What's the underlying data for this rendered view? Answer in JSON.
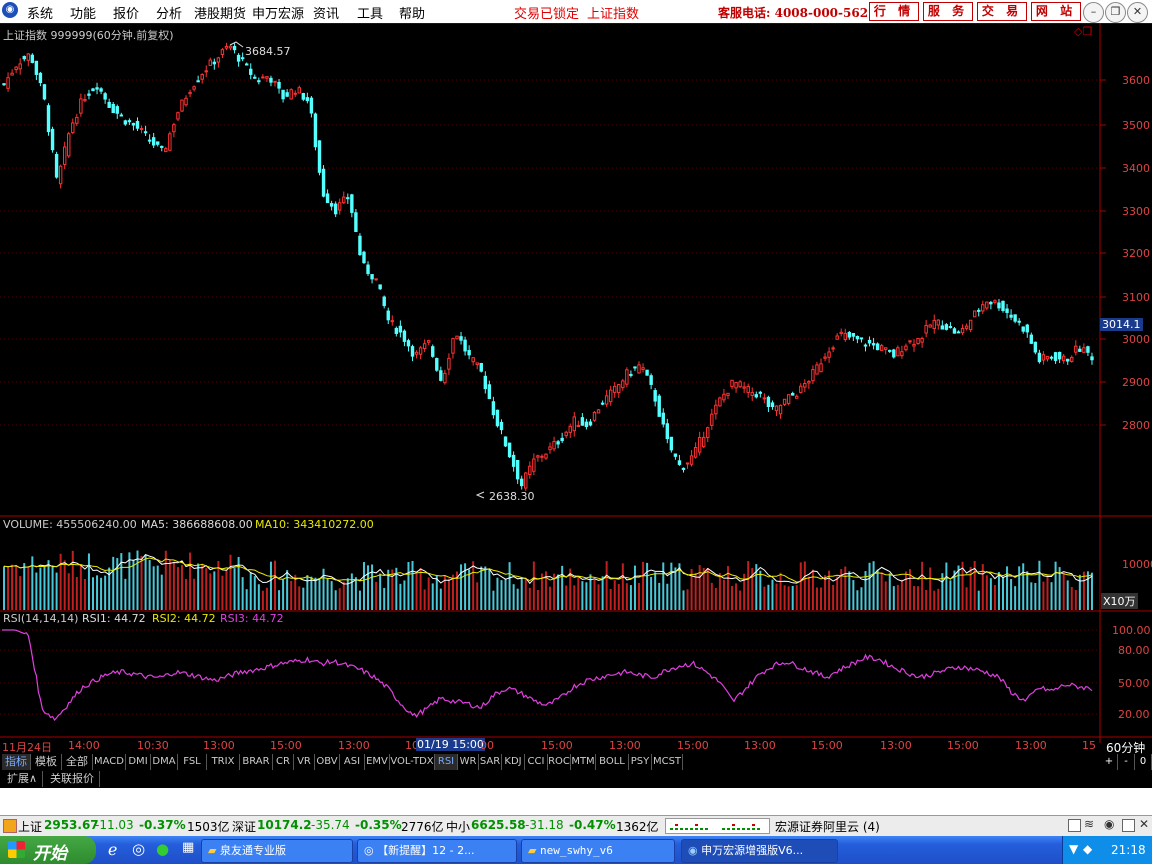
{
  "menubar": {
    "items": [
      "系统",
      "功能",
      "报价",
      "分析",
      "港股期货",
      "申万宏源",
      "资讯",
      "工具",
      "帮助"
    ],
    "lock_status": "交易已锁定",
    "index_name": "上证指数",
    "hotline": "客服电话: 4008-000-562",
    "buttons": [
      "行 情",
      "服 务",
      "交 易",
      "网 站"
    ]
  },
  "price_panel": {
    "title": "上证指数 999999(60分钟.前复权)",
    "high_label": "3684.57",
    "low_label": "2638.30",
    "current_price": "3014.1",
    "y_ticks": [
      "3600",
      "3500",
      "3400",
      "3300",
      "3200",
      "3100",
      "3000",
      "2900",
      "2800"
    ]
  },
  "volume_panel": {
    "prefix": "VOLUME: ",
    "volume": "455506240.00",
    "ma5_label": "MA5: ",
    "ma5": "386688608.00",
    "ma10_label": "MA10: ",
    "ma10": "343410272.00",
    "y_tick": "10000",
    "unit": "X10万"
  },
  "rsi_panel": {
    "title": "RSI(14,14,14)",
    "rsi1": "RSI1: 44.72",
    "rsi2": "RSI2: 44.72",
    "rsi3": "RSI3: 44.72",
    "y_ticks": [
      "100.00",
      "80.00",
      "50.00",
      "20.00"
    ]
  },
  "time_axis": {
    "labels": [
      "11月24日",
      "14:00",
      "10:30",
      "13:00",
      "15:00",
      "13:00",
      "10",
      "01/19 15:00",
      "00",
      "15:00",
      "13:00",
      "15:00",
      "13:00",
      "15:00",
      "13:00",
      "15:00",
      "13:00",
      "15"
    ],
    "period": "60分钟"
  },
  "indicator_tabs": [
    "指标",
    "模板",
    "全部",
    "MACD",
    "DMI",
    "DMA",
    "FSL",
    "TRIX",
    "BRAR",
    "CR",
    "VR",
    "OBV",
    "ASI",
    "EMV",
    "VOL-TDX",
    "RSI",
    "WR",
    "SAR",
    "KDJ",
    "CCI",
    "ROC",
    "MTM",
    "BOLL",
    "PSY",
    "MCST"
  ],
  "zoom_controls": [
    "+",
    "-",
    "0"
  ],
  "extension_row": [
    "扩展∧",
    "关联报价"
  ],
  "status_bar": {
    "sh_name": "上证",
    "sh_val": "2953.67",
    "sh_chg": "-11.03",
    "sh_pct": "-0.37%",
    "sh_amt": "1503亿",
    "sz_name": "深证",
    "sz_val": "10174.2",
    "sz_chg": "-35.74",
    "sz_pct": "-0.35%",
    "sz_amt": "2776亿",
    "zx_name": "中小",
    "zx_val": "6625.58",
    "zx_chg": "-31.18",
    "zx_pct": "-0.47%",
    "zx_amt": "1362亿",
    "broker": "宏源证券阿里云 (4)"
  },
  "taskbar": {
    "start": "开始",
    "tasks": [
      "泉友通专业版",
      "【新提醒】12 - 2...",
      "new_swhy_v6",
      "申万宏源增强版V6..."
    ],
    "clock": "21:18"
  },
  "chart_data": [
    {
      "type": "candlestick",
      "title": "上证指数 999999(60分钟.前复权)",
      "interval": "60分钟",
      "ylim": [
        2600,
        3700
      ],
      "y_ticks": [
        2800,
        2900,
        3000,
        3100,
        3200,
        3300,
        3400,
        3500,
        3600
      ],
      "annotations": [
        {
          "label": "3684.57",
          "type": "high"
        },
        {
          "label": "2638.30",
          "type": "low"
        }
      ],
      "last_price": 3014.1,
      "close_path": [
        3590,
        3640,
        3660,
        3560,
        3360,
        3490,
        3560,
        3590,
        3540,
        3510,
        3490,
        3460,
        3430,
        3520,
        3580,
        3620,
        3650,
        3680,
        3640,
        3600,
        3610,
        3560,
        3580,
        3550,
        3340,
        3300,
        3330,
        3170,
        3140,
        3040,
        3010,
        2960,
        2990,
        2900,
        3020,
        2960,
        2920,
        2820,
        2740,
        2660,
        2720,
        2740,
        2770,
        2810,
        2800,
        2850,
        2880,
        2920,
        2940,
        2870,
        2760,
        2700,
        2730,
        2800,
        2860,
        2900,
        2880,
        2870,
        2830,
        2860,
        2880,
        2920,
        2970,
        3010,
        3000,
        2990,
        2980,
        2960,
        2990,
        3000,
        3040,
        3030,
        3010,
        3050,
        3090,
        3080,
        3050,
        3020,
        2950,
        2960,
        2950,
        2980,
        2960
      ]
    },
    {
      "type": "bar",
      "title": "VOLUME",
      "unit": "X10万",
      "y_ticks": [
        10000
      ],
      "series": [
        {
          "name": "MA5",
          "last": 386688608.0
        },
        {
          "name": "MA10",
          "last": 343410272.0
        }
      ],
      "last_volume": 455506240.0
    },
    {
      "type": "line",
      "title": "RSI(14,14,14)",
      "ylim": [
        0,
        100
      ],
      "y_ticks": [
        20,
        50,
        80,
        100
      ],
      "series": [
        {
          "name": "RSI3",
          "last": 44.72,
          "values": [
            100,
            100,
            95,
            25,
            15,
            30,
            45,
            52,
            58,
            60,
            58,
            55,
            55,
            60,
            58,
            55,
            52,
            56,
            60,
            62,
            65,
            68,
            70,
            72,
            68,
            70,
            66,
            62,
            55,
            45,
            30,
            18,
            25,
            35,
            32,
            30,
            26,
            38,
            45,
            40,
            33,
            28,
            35,
            46,
            52,
            55,
            58,
            60,
            57,
            55,
            62,
            66,
            68,
            60,
            50,
            32,
            45,
            58,
            66,
            70,
            65,
            60,
            55,
            62,
            68,
            74,
            72,
            65,
            60,
            55,
            58,
            62,
            65,
            63,
            60,
            55,
            40,
            32,
            45,
            42,
            48,
            46,
            44
          ]
        }
      ]
    }
  ]
}
